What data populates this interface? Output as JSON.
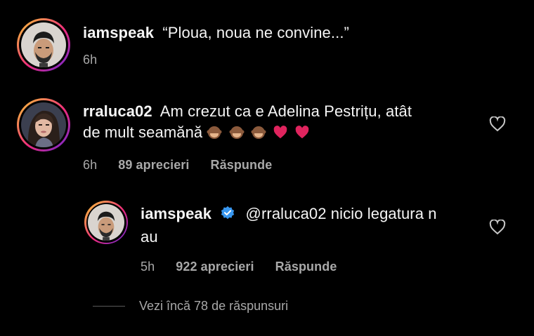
{
  "comments": [
    {
      "username": "iamspeak",
      "text": "“Ploua, noua ne convine...”",
      "time": "6h"
    },
    {
      "username": "rraluca02",
      "text_line1": "Am crezut ca e Adelina Pestrițu, atât",
      "text_line2": "de mult seamănă",
      "emojis": [
        "see-no-evil-monkey",
        "see-no-evil-monkey",
        "see-no-evil-monkey",
        "red-heart",
        "red-heart"
      ],
      "time": "6h",
      "likes": "89 aprecieri",
      "reply_label": "Răspunde"
    },
    {
      "username": "iamspeak",
      "verified": true,
      "text_line1": "@rraluca02 nicio legatura n",
      "text_line2": "au",
      "time": "5h",
      "likes": "922 aprecieri",
      "reply_label": "Răspunde"
    }
  ],
  "view_more": "Vezi încă 78 de răspunsuri",
  "colors": {
    "background": "#000000",
    "text": "#f5f5f5",
    "secondary": "#a8a8a8",
    "verified": "#3897f0",
    "heart": "#e0245e"
  }
}
